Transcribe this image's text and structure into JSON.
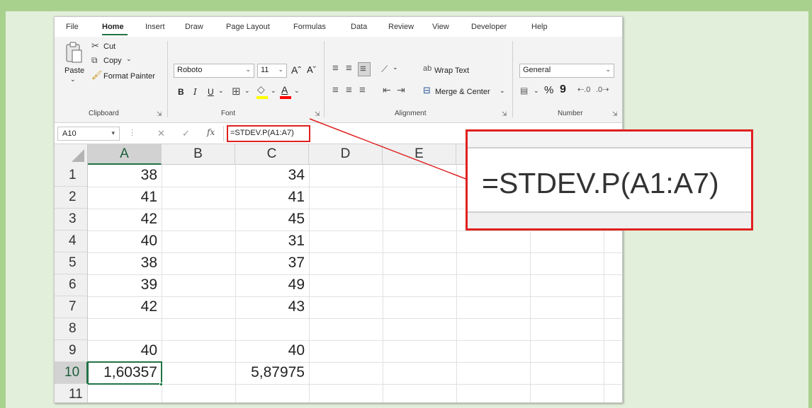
{
  "menu_tabs": [
    {
      "label": "File"
    },
    {
      "label": "Home"
    },
    {
      "label": "Insert"
    },
    {
      "label": "Draw"
    },
    {
      "label": "Page Layout"
    },
    {
      "label": "Formulas"
    },
    {
      "label": "Data"
    },
    {
      "label": "Review"
    },
    {
      "label": "View"
    },
    {
      "label": "Developer"
    },
    {
      "label": "Help"
    }
  ],
  "ribbon": {
    "clipboard": {
      "paste": "Paste",
      "cut": "Cut",
      "copy": "Copy",
      "format_painter": "Format Painter",
      "group_label": "Clipboard"
    },
    "font": {
      "font_name": "Roboto",
      "font_size": "11",
      "grow": "Aˆ",
      "shrink": "Aˇ",
      "bold": "B",
      "italic": "I",
      "underline": "U",
      "group_label": "Font"
    },
    "alignment": {
      "wrap_text": "Wrap Text",
      "merge_center": "Merge & Center",
      "group_label": "Alignment"
    },
    "number": {
      "format": "General",
      "percent": "%",
      "comma": "9",
      "group_label": "Number"
    }
  },
  "formula_bar": {
    "name_box": "A10",
    "formula": "=STDEV.P(A1:A7)"
  },
  "sheet": {
    "columns": [
      "A",
      "B",
      "C",
      "D",
      "E"
    ],
    "rows": [
      {
        "num": "1",
        "a": "38",
        "c": "34"
      },
      {
        "num": "2",
        "a": "41",
        "c": "41"
      },
      {
        "num": "3",
        "a": "42",
        "c": "45"
      },
      {
        "num": "4",
        "a": "40",
        "c": "31"
      },
      {
        "num": "5",
        "a": "38",
        "c": "37"
      },
      {
        "num": "6",
        "a": "39",
        "c": "49"
      },
      {
        "num": "7",
        "a": "42",
        "c": "43"
      },
      {
        "num": "8",
        "a": "",
        "c": ""
      },
      {
        "num": "9",
        "a": "40",
        "c": "40"
      },
      {
        "num": "10",
        "a": "1,60357",
        "c": "5,87975"
      },
      {
        "num": "11",
        "a": "",
        "c": ""
      }
    ],
    "active_cell": "A10"
  },
  "zoom_callout": {
    "text": "=STDEV.P(A1:A7)",
    "border_color": "#e02020"
  },
  "colors": {
    "accent": "#217346",
    "frame": "#a9d18e",
    "background": "#e2efda"
  }
}
